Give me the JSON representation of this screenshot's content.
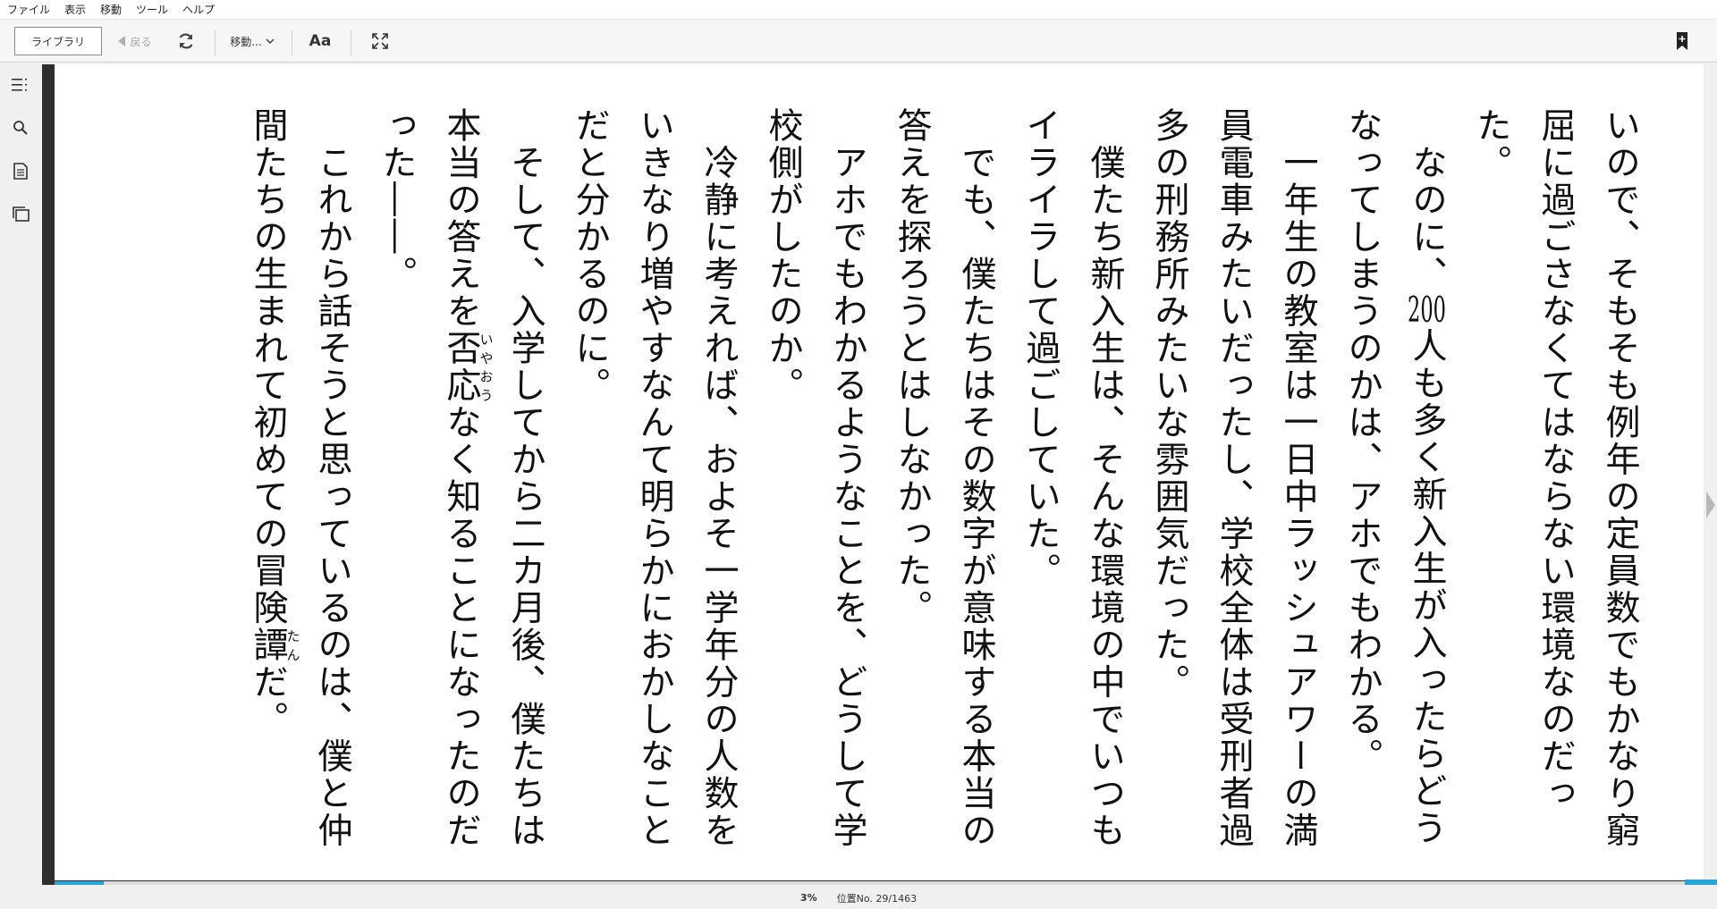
{
  "menubar": {
    "items": [
      "ファイル",
      "表示",
      "移動",
      "ツール",
      "ヘルプ"
    ]
  },
  "toolbar": {
    "library_label": "ライブラリ",
    "back_label": "戻る",
    "goto_label": "移動...",
    "font_label": "Aa",
    "icons": [
      "refresh-icon",
      "chevron-down-icon",
      "fullscreen-icon",
      "add-bookmark-icon"
    ]
  },
  "sidebar": {
    "icons": [
      "table-of-contents-icon",
      "search-icon",
      "notes-icon",
      "flashcards-icon"
    ]
  },
  "book": {
    "p1": "いので、そもそも例年の定員数でもかなり窮屈に過ごさなくてはならない環境なのだった。",
    "p2a": "なのに、",
    "p2num": "200",
    "p2b": "人も多く新入生が入ったらどうなってしまうのかは、アホでもわかる。",
    "p3": "一年生の教室は一日中ラッシュアワーの満員電車みたいだったし、学校全体は受刑者過多の刑務所みたいな雰囲気だった。",
    "p4": "僕たち新入生は、そんな環境の中でいつもイライラして過ごしていた。",
    "p5": "でも、僕たちはその数字が意味する本当の答えを探ろうとはしなかった。",
    "p6": "アホでもわかるようなことを、どうして学校側がしたのか。",
    "p7": "冷静に考えれば、およそ一学年分の人数をいきなり増やすなんて明らかにおかしなことだと分かるのに。",
    "p8a": "そして、入学してから二カ月後、僕たちは本当の答えを",
    "p8ruby": "否応",
    "p8rt": "いやおう",
    "p8b": "なく知ることになったのだった――。",
    "p9a": "これから話そうと思っているのは、僕と仲間たちの生まれて初めての冒険",
    "p9ruby": "譚",
    "p9rt": "たん",
    "p9b": "だ。"
  },
  "status": {
    "percent": "3%",
    "position": "位置No. 29/1463",
    "progress_fraction": 0.03
  },
  "colors": {
    "accent": "#29a6d8",
    "page_frame": "#2e2e2e",
    "page": "#ffffff"
  }
}
